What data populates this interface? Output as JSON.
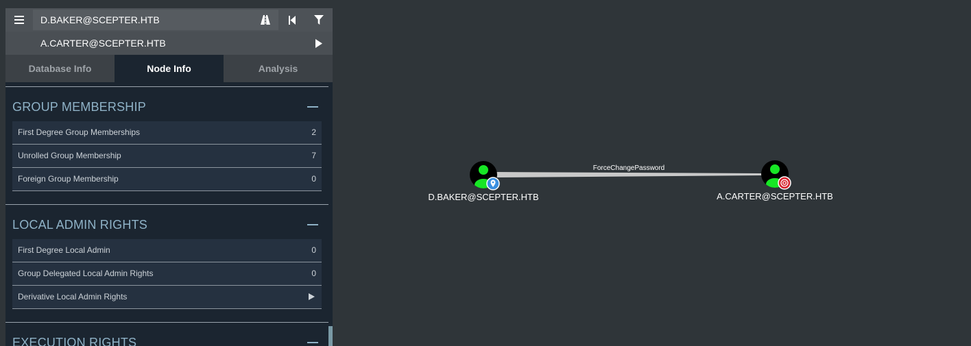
{
  "search": {
    "source": "D.BAKER@SCEPTER.HTB",
    "target": "A.CARTER@SCEPTER.HTB"
  },
  "toolbar": {
    "menu_icon": "hamburger-icon",
    "pathfinding_icon": "road-icon",
    "back_icon": "skip-back-icon",
    "filter_icon": "filter-icon",
    "play_icon": "play-icon"
  },
  "tabs": [
    {
      "label": "Database Info",
      "active": false
    },
    {
      "label": "Node Info",
      "active": true
    },
    {
      "label": "Analysis",
      "active": false
    }
  ],
  "sections": {
    "group_membership": {
      "title": "GROUP MEMBERSHIP",
      "rows": [
        {
          "label": "First Degree Group Memberships",
          "value": "2"
        },
        {
          "label": "Unrolled Group Membership",
          "value": "7"
        },
        {
          "label": "Foreign Group Membership",
          "value": "0"
        }
      ]
    },
    "local_admin": {
      "title": "LOCAL ADMIN RIGHTS",
      "rows": [
        {
          "label": "First Degree Local Admin",
          "value": "0"
        },
        {
          "label": "Group Delegated Local Admin Rights",
          "value": "0"
        },
        {
          "label": "Derivative Local Admin Rights",
          "value": ""
        }
      ]
    },
    "execution": {
      "title": "EXECUTION RIGHTS"
    }
  },
  "graph": {
    "source_node": {
      "label": "D.BAKER@SCEPTER.HTB",
      "badge_icon": "map-pin-icon"
    },
    "target_node": {
      "label": "A.CARTER@SCEPTER.HTB",
      "badge_icon": "target-icon"
    },
    "edge": {
      "label": "ForceChangePassword"
    }
  },
  "colors": {
    "background": "#2f3539",
    "user_node": "#17e625",
    "panel_content": "#1b2530",
    "section_title": "#8fb2c7",
    "source_badge": "#3a8fe0",
    "target_badge": "#d6222d"
  }
}
